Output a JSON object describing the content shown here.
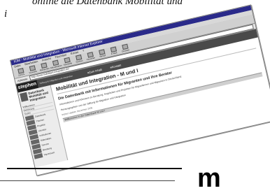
{
  "caption": {
    "line1": "online die Datenbank Mobilität und",
    "line2": "i"
  },
  "window": {
    "title": "IOM - Mobilität und Integration - Microsoft Internet Explorer",
    "menu": [
      "Datei",
      "Bearbeiten",
      "Ansicht",
      "Favoriten",
      "Extras",
      "?"
    ],
    "toolbar": [
      "Zurück",
      "Vorwärts",
      "Abbrechen",
      "Aktualisieren",
      "Startseite",
      "Suchen",
      "Favoriten",
      "Verlauf",
      "E-Mail",
      "Drucken"
    ],
    "address_label": "Adresse",
    "address_value": "http://www.mobilitaet-integration.de/"
  },
  "site": {
    "logo": "stephen",
    "subtitle": "Stiftung für Migration und Integration",
    "nav": [
      "Zum Inhalt",
      "Kontakt"
    ],
    "sidebar": {
      "brand": "Datenbank Mobilität und Integration",
      "links": [
        "Willkommen",
        "Einführung",
        "Suche"
      ],
      "items": [
        "Datenbank",
        "Themen",
        "Projekte",
        "Literatur",
        "Institutionen",
        "Materialien",
        "Service",
        "Beratung",
        "Impressum"
      ]
    },
    "main": {
      "title": "Mobilität und Integration - M und I",
      "heading": "Die Datenbank mit Informationen für Migranten und ihre Berater",
      "intro": "Informationen und Adressen zu Beratung, Angeboten und Projekten für Migrantinnen und Migranten in Deutschland.",
      "credit": "Herausgegeben von der Stiftung für Migration und Integration",
      "updated": "letztes Update: Dezember 2005",
      "welcome_bar": "Willkommen in der Datenbank M und I"
    }
  },
  "footer": {
    "logo": "m"
  }
}
